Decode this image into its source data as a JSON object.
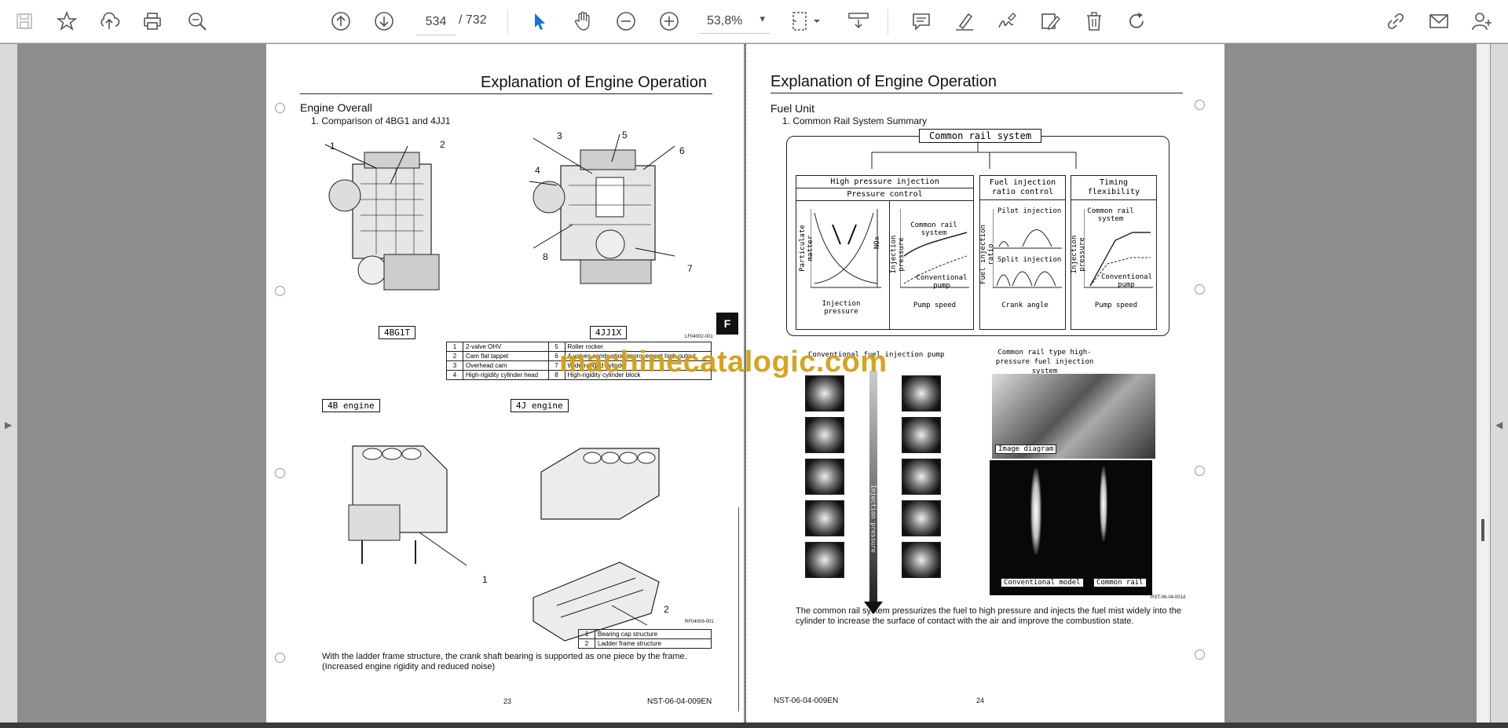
{
  "toolbar": {
    "page_current": "534",
    "page_total": "/  732",
    "zoom": "53,8%",
    "left_tools": [
      "save-icon",
      "bookmark-star-icon",
      "upload-cloud-icon",
      "print-icon",
      "zoom-search-icon"
    ],
    "nav_tools": [
      "page-up-icon",
      "page-down-icon"
    ],
    "right_tools": [
      "comment-icon",
      "highlight-icon",
      "sign-icon",
      "edit-icon",
      "delete-icon",
      "rotate-icon"
    ],
    "far_right_tools": [
      "share-link-icon",
      "email-icon",
      "add-user-icon"
    ]
  },
  "watermark": "machinecatalogic.com",
  "left_page": {
    "title": "Explanation of Engine Operation",
    "section": "Engine Overall",
    "subsection": "1. Comparison of 4BG1 and 4JJ1",
    "engine_a_label": "4BG1T",
    "engine_b_label": "4JJ1X",
    "fig_code_1": "LF04002-001",
    "fig_code_2": "RF04009-001",
    "callouts_top": [
      "1",
      "2",
      "3",
      "4",
      "5",
      "6",
      "7",
      "8"
    ],
    "callouts_bottom": [
      "1",
      "2"
    ],
    "legend": [
      [
        "1",
        "2-valve OHV",
        "5",
        "Roller rocker"
      ],
      [
        "2",
        "Cam flat tappet",
        "6",
        "4-valves combustion improvement high output"
      ],
      [
        "3",
        "Overhead cam",
        "7",
        "Wide-ranged cylinder"
      ],
      [
        "4",
        "High-rigidity cylinder head",
        "8",
        "High-rigidity cylinder block"
      ]
    ],
    "block_label_a": "4B engine",
    "block_label_b": "4J engine",
    "legend2": [
      [
        "1",
        "Bearing cap structure"
      ],
      [
        "2",
        "Ladder frame structure"
      ]
    ],
    "paragraph": "With the ladder frame structure, the crank shaft bearing is supported as one piece by the frame. (Increased engine rigidity and reduced noise)",
    "page_number": "23",
    "doc_code": "NST-06-04-009EN",
    "side_tab": "F"
  },
  "right_page": {
    "title": "Explanation of Engine Operation",
    "section": "Fuel Unit",
    "subsection": "1. Common Rail System Summary",
    "diagram": {
      "root": "Common rail system",
      "col1_head": "High pressure injection",
      "col1_sub": "Pressure control",
      "col2_head": "Fuel injection ratio control",
      "col3_head": "Timing flexibility",
      "g1_ylabel": "Particulate matter",
      "g1_y2": "NOx",
      "g1_xlabel": "Injection pressure",
      "g2_ylabel": "Injection pressure",
      "g2_top": "Common rail system",
      "g2_bottom": "Conventional pump",
      "g2_xlabel": "Pump speed",
      "g3_ylabel": "Fuel injection ratio",
      "g3_top": "Pilot injection",
      "g3_mid": "Split injection",
      "g3_xlabel": "Crank angle",
      "g4_ylabel": "Injection pressure",
      "g4_top": "Common rail system",
      "g4_bottom": "Conventional pump",
      "g4_xlabel": "Pump speed"
    },
    "photo_left_title": "Conventional fuel injection pump",
    "photo_arrow_text": "Injection pressure",
    "photo_right_title": "Common rail type high-pressure fuel injection system",
    "image_diagram_label": "Image diagram",
    "conventional_model": "Conventional model",
    "common_rail_label": "Common rail",
    "fig_code": "RST-06-04-001d",
    "paragraph": "The common rail system pressurizes the fuel to high pressure and injects the fuel mist widely into the cylinder to increase the surface of contact with the air and improve the combustion state.",
    "page_number": "24",
    "doc_code": "NST-06-04-009EN"
  }
}
